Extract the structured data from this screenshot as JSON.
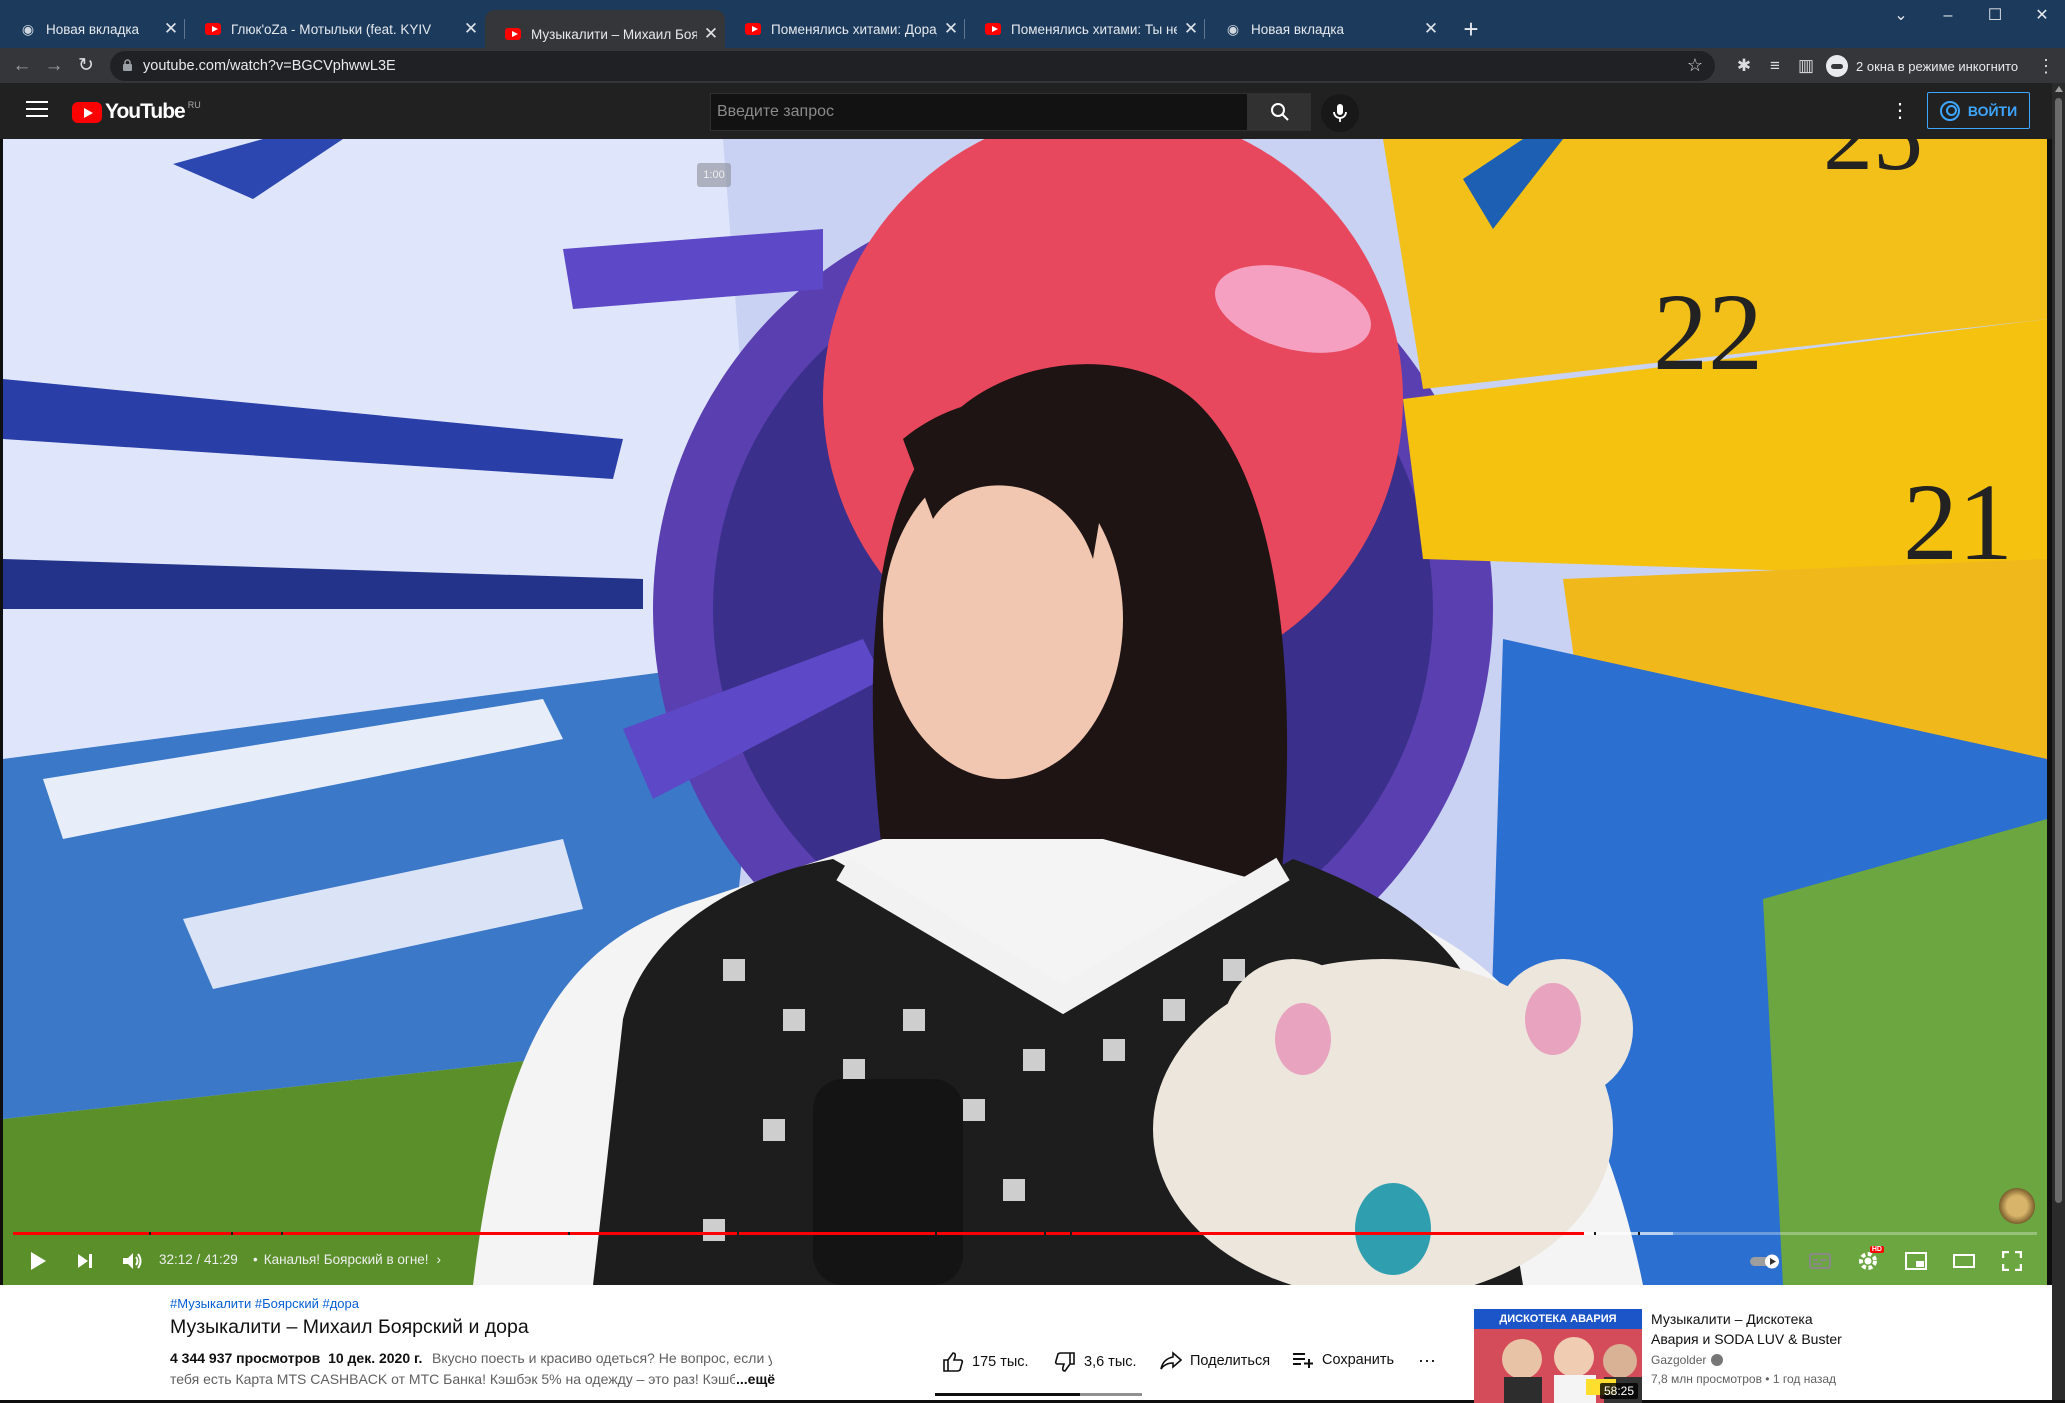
{
  "browser": {
    "tabs": [
      {
        "title": "Новая вкладка",
        "icon": "incognito-icon",
        "active": false
      },
      {
        "title": "Глюк'oZa - Мотыльки (feat. KYIV",
        "icon": "youtube-icon",
        "active": false
      },
      {
        "title": "Музыкалити – Михаил Боярский",
        "icon": "youtube-icon",
        "active": true
      },
      {
        "title": "Поменялись хитами: Дорадура",
        "icon": "youtube-icon",
        "active": false
      },
      {
        "title": "Поменялись хитами: Ты не вер",
        "icon": "youtube-icon",
        "active": false
      },
      {
        "title": "Новая вкладка",
        "icon": "incognito-icon",
        "active": false
      }
    ],
    "url": "youtube.com/watch?v=BGCVphwwL3E",
    "incognito_label": "2 окна в режиме инкогнито"
  },
  "youtube": {
    "logo_text": "YouTube",
    "region": "RU",
    "search_placeholder": "Введите запрос",
    "signin_label": "ВОЙТИ"
  },
  "player": {
    "hover_time": "1:00",
    "current_time": "32:12",
    "duration": "41:29",
    "time_display": "32:12 / 41:29",
    "chapter_title": "Каналья! Боярский в огне!",
    "played_fraction": 0.776,
    "buffered_fraction": 0.82,
    "hd_badge": "HD"
  },
  "video": {
    "hashtags": "#Музыкалити #Боярский #дора",
    "title": "Музыкалити – Михаил Боярский и дора",
    "views": "4 344 937 просмотров",
    "date": "10 дек. 2020 г.",
    "description_line1": "Вкусно поесть и красиво одеться? Не вопрос, если у",
    "description_line2": "тебя есть Карта MTS CASHBACK от МТС Банка! Кэшбэк 5% на одежду – это раз! Кэшбэк",
    "more_label": "...ещё",
    "likes": "175 тыс.",
    "dislikes": "3,6 тыс.",
    "share_label": "Поделиться",
    "save_label": "Сохранить"
  },
  "recommendation": {
    "title": "Музыкалити – Дискотека Авария и SODA LUV & Buster",
    "channel": "Gazgolder",
    "meta": "7,8 млн просмотров • 1 год назад",
    "duration": "58:25",
    "thumb_banner": "ДИСКОТЕКА АВАРИЯ"
  }
}
